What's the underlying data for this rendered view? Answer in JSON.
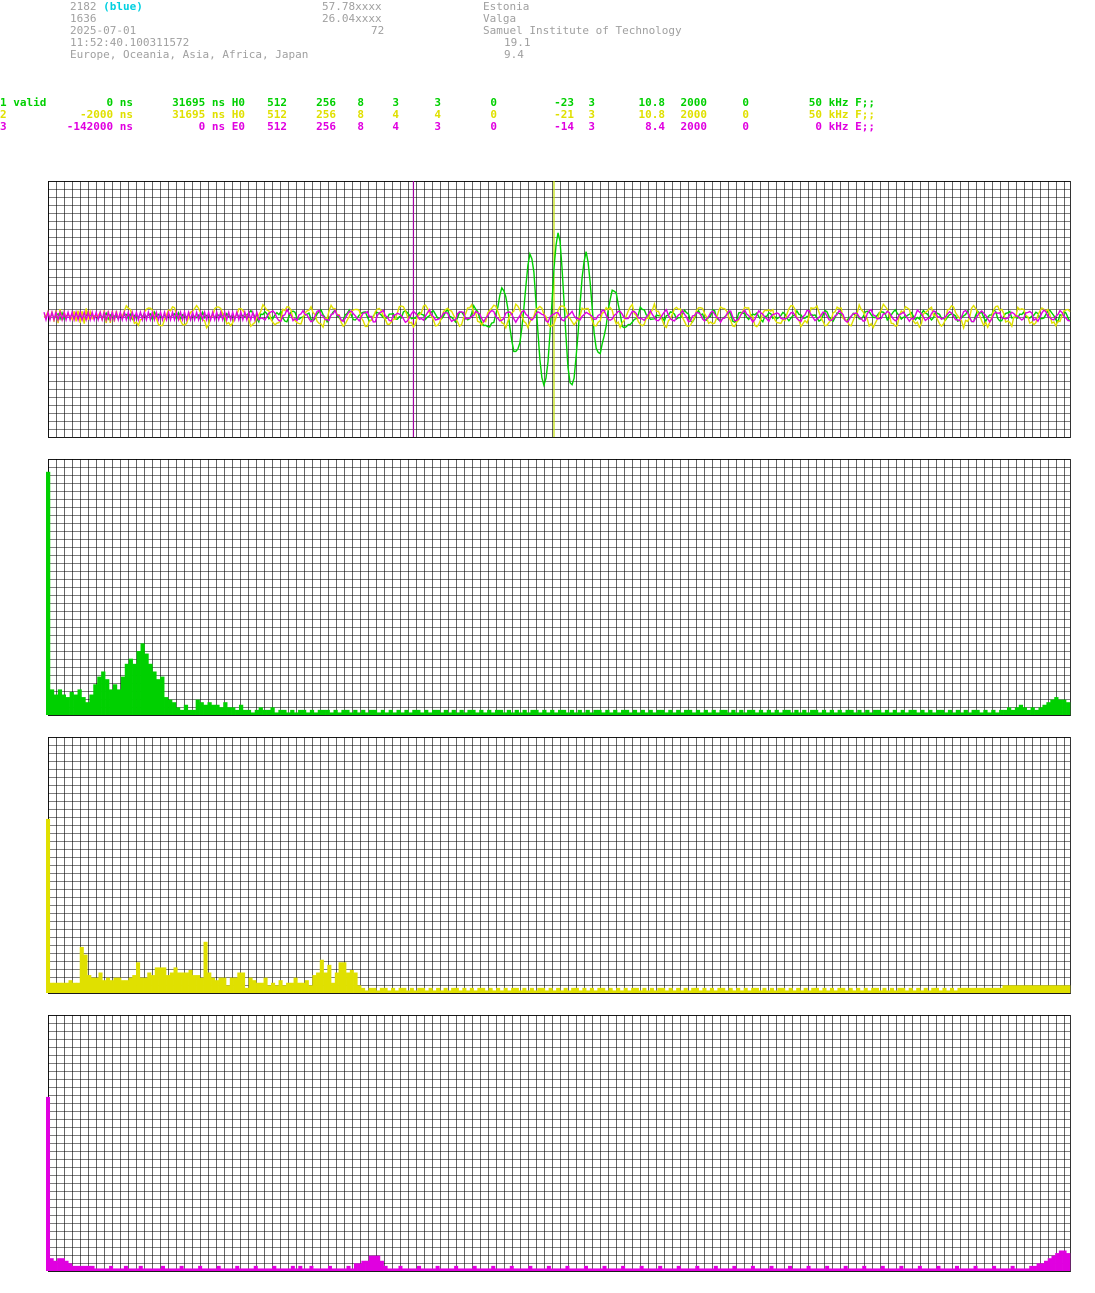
{
  "header": {
    "station_id": "2182",
    "station_tag": "(blue)",
    "number": "1636",
    "date": "2025-07-01",
    "time": "11:52:40.100311572",
    "regions": "Europe, Oceania, Asia, Africa, Japan",
    "lat": "57.78xxxx",
    "lon": "26.04xxxx",
    "alt": "72",
    "country": "Estonia",
    "city": "Valga",
    "institution": "Samuel Institute of Technology",
    "val1": "19.1",
    "val2": "9.4"
  },
  "colors": {
    "ch1": "#00d000",
    "ch2": "#e0e000",
    "ch3": "#e000e0",
    "grid": "#000000"
  },
  "channels": [
    {
      "c0": "1 valid",
      "c1": "0 ns",
      "c2": "31695 ns H0",
      "c3": "512",
      "c4": "256",
      "c5": "8",
      "c6": "3",
      "c7": "3",
      "c8": "0",
      "c9": "-23",
      "c10": "3",
      "c11": "10.8",
      "c12": "2000",
      "c13": "0",
      "c14": "50 kHz F;;"
    },
    {
      "c0": "2",
      "c1": "-2000 ns",
      "c2": "31695 ns H0",
      "c3": "512",
      "c4": "256",
      "c5": "8",
      "c6": "4",
      "c7": "4",
      "c8": "0",
      "c9": "-21",
      "c10": "3",
      "c11": "10.8",
      "c12": "2000",
      "c13": "0",
      "c14": "50 kHz F;;"
    },
    {
      "c0": "3",
      "c1": "-142000 ns",
      "c2": "0 ns E0",
      "c3": "512",
      "c4": "256",
      "c5": "8",
      "c6": "4",
      "c7": "3",
      "c8": "0",
      "c9": "-14",
      "c10": "3",
      "c11": "8.4",
      "c12": "2000",
      "c13": "0",
      "c14": "0 kHz E;;"
    }
  ],
  "chart_data": [
    {
      "type": "line",
      "x_range": [
        0,
        511
      ],
      "ylim": [
        -1,
        1
      ],
      "grid": true,
      "markers": [
        {
          "x": 184,
          "color": "#a000a0"
        },
        {
          "x": 254,
          "color": "#c0e000"
        }
      ],
      "series": [
        {
          "color": "#00d000",
          "peak_x": 256,
          "peak_value": 0.62,
          "baseline": 0.0
        },
        {
          "color": "#e0e000",
          "peak_x": 0,
          "peak_value": 0.1,
          "baseline": 0.0
        },
        {
          "color": "#e000e0",
          "peak_x": 0,
          "peak_value": 0.05,
          "baseline": 0.0
        }
      ]
    },
    {
      "type": "bar",
      "color": "#00d000",
      "ylim": [
        0,
        1
      ],
      "grid": true,
      "values": [
        0.95,
        0.1,
        0.08,
        0.1,
        0.08,
        0.07,
        0.09,
        0.08,
        0.1,
        0.07,
        0.05,
        0.08,
        0.12,
        0.15,
        0.17,
        0.14,
        0.1,
        0.12,
        0.1,
        0.15,
        0.2,
        0.22,
        0.2,
        0.25,
        0.28,
        0.24,
        0.2,
        0.17,
        0.14,
        0.15,
        0.07,
        0.06,
        0.05,
        0.03,
        0.02,
        0.04,
        0.02,
        0.02,
        0.06,
        0.05,
        0.04,
        0.05,
        0.04,
        0.04,
        0.03,
        0.05,
        0.03,
        0.03,
        0.02,
        0.04,
        0.02,
        0.02,
        0.01,
        0.02,
        0.03,
        0.02,
        0.02,
        0.03,
        0.01,
        0.02,
        0.02,
        0.01,
        0.02,
        0.01,
        0.02,
        0.02,
        0.01,
        0.02,
        0.01,
        0.02,
        0.02,
        0.02,
        0.01,
        0.02,
        0.01,
        0.02,
        0.02,
        0.01,
        0.02,
        0.01,
        0.02,
        0.01,
        0.02,
        0.02,
        0.01,
        0.02,
        0.01,
        0.02,
        0.01,
        0.02,
        0.01,
        0.02,
        0.01,
        0.02,
        0.02,
        0.01,
        0.02,
        0.01,
        0.02,
        0.02,
        0.01,
        0.02,
        0.01,
        0.02,
        0.01,
        0.02,
        0.01,
        0.02,
        0.02,
        0.01,
        0.02,
        0.01,
        0.02,
        0.01,
        0.02,
        0.02,
        0.01,
        0.02,
        0.01,
        0.02,
        0.01,
        0.02,
        0.01,
        0.02,
        0.02,
        0.01,
        0.02,
        0.01,
        0.02,
        0.01,
        0.02,
        0.02,
        0.01,
        0.02,
        0.01,
        0.02,
        0.01,
        0.02,
        0.01,
        0.02,
        0.02,
        0.01,
        0.02,
        0.01,
        0.02,
        0.01,
        0.02,
        0.02,
        0.01,
        0.02,
        0.01,
        0.02,
        0.01,
        0.02,
        0.01,
        0.02,
        0.02,
        0.01,
        0.02,
        0.01,
        0.02,
        0.01,
        0.02,
        0.02,
        0.01,
        0.02,
        0.01,
        0.02,
        0.01,
        0.02,
        0.01,
        0.02,
        0.02,
        0.01,
        0.02,
        0.01,
        0.02,
        0.01,
        0.02,
        0.02,
        0.01,
        0.02,
        0.01,
        0.02,
        0.01,
        0.02,
        0.01,
        0.02,
        0.02,
        0.01,
        0.02,
        0.01,
        0.02,
        0.01,
        0.02,
        0.02,
        0.01,
        0.02,
        0.01,
        0.02,
        0.01,
        0.02,
        0.01,
        0.02,
        0.02,
        0.01,
        0.02,
        0.01,
        0.02,
        0.01,
        0.02,
        0.02,
        0.01,
        0.02,
        0.01,
        0.02,
        0.01,
        0.02,
        0.01,
        0.02,
        0.02,
        0.01,
        0.02,
        0.01,
        0.02,
        0.01,
        0.02,
        0.02,
        0.01,
        0.02,
        0.01,
        0.02,
        0.01,
        0.02,
        0.01,
        0.02,
        0.02,
        0.01,
        0.02,
        0.01,
        0.02,
        0.01,
        0.02,
        0.02,
        0.03,
        0.02,
        0.03,
        0.04,
        0.03,
        0.02,
        0.03,
        0.02,
        0.03,
        0.04,
        0.05,
        0.06,
        0.07,
        0.06,
        0.06,
        0.05
      ]
    },
    {
      "type": "bar",
      "color": "#e0e000",
      "ylim": [
        0,
        1
      ],
      "grid": true,
      "values": [
        0.68,
        0.04,
        0.04,
        0.04,
        0.04,
        0.04,
        0.05,
        0.04,
        0.04,
        0.18,
        0.15,
        0.07,
        0.06,
        0.06,
        0.08,
        0.05,
        0.06,
        0.05,
        0.06,
        0.06,
        0.05,
        0.05,
        0.06,
        0.07,
        0.12,
        0.06,
        0.06,
        0.08,
        0.07,
        0.1,
        0.1,
        0.1,
        0.07,
        0.08,
        0.1,
        0.08,
        0.08,
        0.08,
        0.09,
        0.07,
        0.07,
        0.06,
        0.2,
        0.08,
        0.06,
        0.05,
        0.06,
        0.06,
        0.03,
        0.06,
        0.06,
        0.08,
        0.08,
        0.02,
        0.06,
        0.05,
        0.04,
        0.04,
        0.06,
        0.03,
        0.04,
        0.03,
        0.05,
        0.03,
        0.04,
        0.04,
        0.06,
        0.04,
        0.04,
        0.05,
        0.03,
        0.07,
        0.08,
        0.13,
        0.08,
        0.11,
        0.04,
        0.08,
        0.12,
        0.12,
        0.08,
        0.09,
        0.08,
        0.03,
        0.02,
        0.01,
        0.02,
        0.02,
        0.01,
        0.02,
        0.02,
        0.01,
        0.02,
        0.01,
        0.02,
        0.02,
        0.01,
        0.02,
        0.01,
        0.02,
        0.02,
        0.01,
        0.02,
        0.01,
        0.02,
        0.01,
        0.02,
        0.01,
        0.02,
        0.02,
        0.01,
        0.02,
        0.01,
        0.02,
        0.01,
        0.02,
        0.02,
        0.01,
        0.02,
        0.01,
        0.02,
        0.01,
        0.02,
        0.01,
        0.02,
        0.02,
        0.01,
        0.02,
        0.01,
        0.02,
        0.01,
        0.02,
        0.02,
        0.01,
        0.02,
        0.01,
        0.02,
        0.01,
        0.02,
        0.01,
        0.02,
        0.02,
        0.01,
        0.02,
        0.01,
        0.02,
        0.01,
        0.02,
        0.02,
        0.01,
        0.02,
        0.01,
        0.02,
        0.01,
        0.02,
        0.01,
        0.02,
        0.02,
        0.01,
        0.02,
        0.01,
        0.02,
        0.01,
        0.02,
        0.02,
        0.01,
        0.02,
        0.01,
        0.02,
        0.01,
        0.02,
        0.01,
        0.02,
        0.02,
        0.01,
        0.02,
        0.01,
        0.02,
        0.01,
        0.02,
        0.02,
        0.01,
        0.02,
        0.01,
        0.02,
        0.01,
        0.02,
        0.01,
        0.02,
        0.02,
        0.01,
        0.02,
        0.01,
        0.02,
        0.01,
        0.02,
        0.02,
        0.01,
        0.02,
        0.01,
        0.02,
        0.01,
        0.02,
        0.01,
        0.02,
        0.02,
        0.01,
        0.02,
        0.01,
        0.02,
        0.01,
        0.02,
        0.02,
        0.01,
        0.02,
        0.01,
        0.02,
        0.01,
        0.02,
        0.01,
        0.02,
        0.02,
        0.01,
        0.02,
        0.01,
        0.02,
        0.01,
        0.02,
        0.02,
        0.01,
        0.02,
        0.01,
        0.02,
        0.01,
        0.02,
        0.01,
        0.02,
        0.02,
        0.01,
        0.02,
        0.01,
        0.02,
        0.01,
        0.02,
        0.02,
        0.02,
        0.02,
        0.02,
        0.02,
        0.02,
        0.02,
        0.02,
        0.02,
        0.02,
        0.02,
        0.03,
        0.03,
        0.03,
        0.03,
        0.03,
        0.03,
        0.03,
        0.03,
        0.03,
        0.03,
        0.03,
        0.03,
        0.03,
        0.03,
        0.03,
        0.03,
        0.03,
        0.03
      ]
    },
    {
      "type": "bar",
      "color": "#e000e0",
      "ylim": [
        0,
        1
      ],
      "grid": true,
      "values": [
        0.68,
        0.05,
        0.04,
        0.05,
        0.05,
        0.04,
        0.03,
        0.02,
        0.02,
        0.02,
        0.02,
        0.02,
        0.02,
        0.01,
        0.01,
        0.01,
        0.01,
        0.02,
        0.01,
        0.01,
        0.01,
        0.02,
        0.01,
        0.01,
        0.01,
        0.02,
        0.01,
        0.01,
        0.01,
        0.01,
        0.01,
        0.02,
        0.01,
        0.01,
        0.01,
        0.01,
        0.02,
        0.01,
        0.01,
        0.01,
        0.01,
        0.02,
        0.01,
        0.01,
        0.01,
        0.01,
        0.02,
        0.01,
        0.01,
        0.01,
        0.01,
        0.02,
        0.01,
        0.01,
        0.01,
        0.01,
        0.02,
        0.01,
        0.01,
        0.01,
        0.01,
        0.02,
        0.01,
        0.01,
        0.01,
        0.01,
        0.02,
        0.01,
        0.02,
        0.01,
        0.01,
        0.02,
        0.01,
        0.01,
        0.01,
        0.01,
        0.02,
        0.01,
        0.01,
        0.01,
        0.01,
        0.02,
        0.01,
        0.03,
        0.03,
        0.04,
        0.04,
        0.06,
        0.06,
        0.06,
        0.04,
        0.02,
        0.01,
        0.01,
        0.01,
        0.02,
        0.01,
        0.01,
        0.01,
        0.01,
        0.02,
        0.01,
        0.01,
        0.01,
        0.01,
        0.02,
        0.01,
        0.01,
        0.01,
        0.01,
        0.02,
        0.01,
        0.01,
        0.01,
        0.01,
        0.02,
        0.01,
        0.01,
        0.01,
        0.01,
        0.02,
        0.01,
        0.01,
        0.01,
        0.01,
        0.02,
        0.01,
        0.01,
        0.01,
        0.01,
        0.02,
        0.01,
        0.01,
        0.01,
        0.01,
        0.02,
        0.01,
        0.01,
        0.01,
        0.01,
        0.02,
        0.01,
        0.01,
        0.01,
        0.01,
        0.02,
        0.01,
        0.01,
        0.01,
        0.01,
        0.02,
        0.01,
        0.01,
        0.01,
        0.01,
        0.02,
        0.01,
        0.01,
        0.01,
        0.01,
        0.02,
        0.01,
        0.01,
        0.01,
        0.01,
        0.02,
        0.01,
        0.01,
        0.01,
        0.01,
        0.02,
        0.01,
        0.01,
        0.01,
        0.01,
        0.02,
        0.01,
        0.01,
        0.01,
        0.01,
        0.02,
        0.01,
        0.01,
        0.01,
        0.01,
        0.02,
        0.01,
        0.01,
        0.01,
        0.01,
        0.02,
        0.01,
        0.01,
        0.01,
        0.01,
        0.02,
        0.01,
        0.01,
        0.01,
        0.01,
        0.02,
        0.01,
        0.01,
        0.01,
        0.01,
        0.02,
        0.01,
        0.01,
        0.01,
        0.01,
        0.02,
        0.01,
        0.01,
        0.01,
        0.01,
        0.02,
        0.01,
        0.01,
        0.01,
        0.01,
        0.02,
        0.01,
        0.01,
        0.01,
        0.01,
        0.02,
        0.01,
        0.01,
        0.01,
        0.01,
        0.02,
        0.01,
        0.01,
        0.01,
        0.01,
        0.02,
        0.01,
        0.01,
        0.01,
        0.01,
        0.02,
        0.01,
        0.01,
        0.01,
        0.01,
        0.02,
        0.01,
        0.01,
        0.01,
        0.01,
        0.02,
        0.01,
        0.01,
        0.01,
        0.01,
        0.02,
        0.01,
        0.01,
        0.01,
        0.01,
        0.02,
        0.01,
        0.01,
        0.01,
        0.01,
        0.02,
        0.02,
        0.03,
        0.03,
        0.04,
        0.05,
        0.06,
        0.07,
        0.08,
        0.08,
        0.07
      ]
    }
  ]
}
